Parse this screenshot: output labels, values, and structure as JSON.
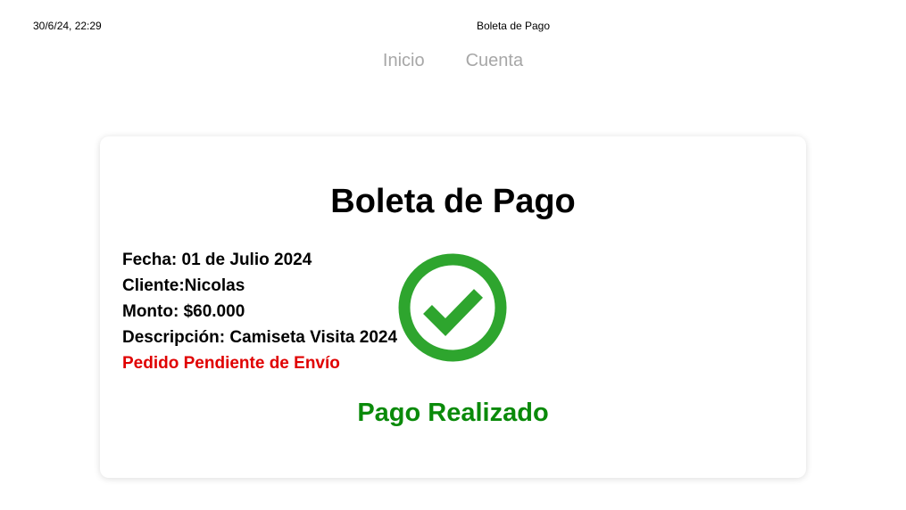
{
  "header": {
    "datetime": "30/6/24, 22:29",
    "page_title": "Boleta de Pago"
  },
  "nav": {
    "items": [
      "Inicio",
      "Cuenta"
    ]
  },
  "receipt": {
    "title": "Boleta de Pago",
    "fecha": "Fecha: 01 de Julio 2024",
    "cliente": "Cliente:Nicolas",
    "monto": "Monto: $60.000",
    "descripcion": "Descripción: Camiseta Visita 2024",
    "estado_envio": "Pedido Pendiente de Envío",
    "status_message": "Pago Realizado",
    "status_icon": "check-circle-icon"
  },
  "colors": {
    "nav_text": "#a7a7a7",
    "pending_red": "#e00000",
    "success_green": "#0a8a0a",
    "check_green": "#2ea52e"
  }
}
